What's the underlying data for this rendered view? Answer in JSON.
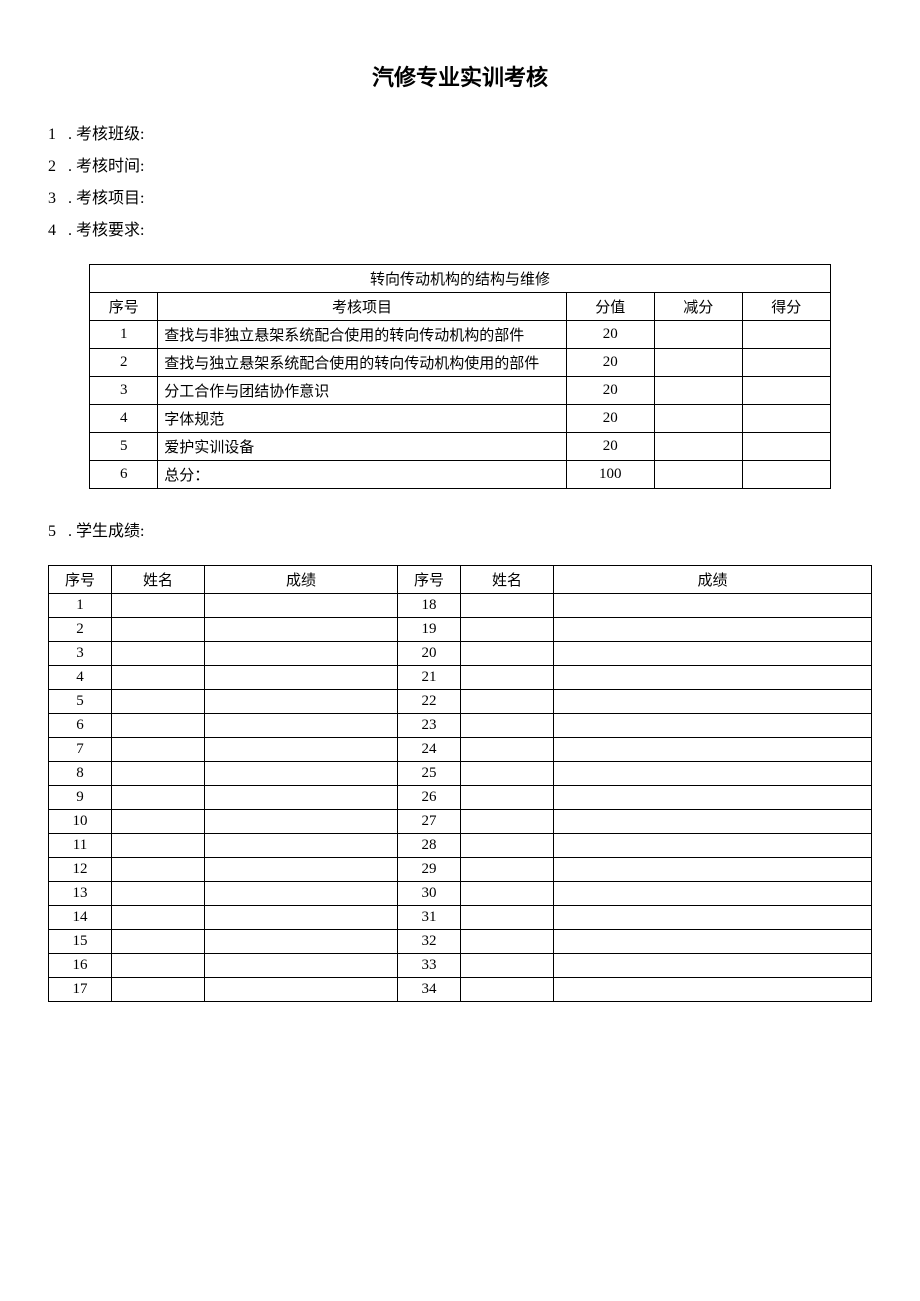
{
  "title": "汽修专业实训考核",
  "meta": [
    {
      "num": "1",
      "label": "考核班级:"
    },
    {
      "num": "2",
      "label": "考核时间:"
    },
    {
      "num": "3",
      "label": "考核项目:"
    },
    {
      "num": "4",
      "label": "考核要求:"
    }
  ],
  "assess": {
    "merged_title": "转向传动机构的结构与维修",
    "headers": {
      "seq": "序号",
      "item": "考核项目",
      "score": "分值",
      "deduct": "减分",
      "get": "得分"
    },
    "rows": [
      {
        "seq": "1",
        "item": "查找与非独立悬架系统配合使用的转向传动机构的部件",
        "score": "20",
        "deduct": "",
        "get": ""
      },
      {
        "seq": "2",
        "item": "查找与独立悬架系统配合使用的转向传动机构使用的部件",
        "score": "20",
        "deduct": "",
        "get": ""
      },
      {
        "seq": "3",
        "item": "分工合作与团结协作意识",
        "score": "20",
        "deduct": "",
        "get": ""
      },
      {
        "seq": "4",
        "item": "字体规范",
        "score": "20",
        "deduct": "",
        "get": ""
      },
      {
        "seq": "5",
        "item": "爱护实训设备",
        "score": "20",
        "deduct": "",
        "get": ""
      },
      {
        "seq": "6",
        "item": "总分：",
        "score": "100",
        "deduct": "",
        "get": ""
      }
    ]
  },
  "grades_meta": {
    "num": "5",
    "label": "学生成绩:"
  },
  "grades": {
    "headers": {
      "seq": "序号",
      "name": "姓名",
      "score": "成绩"
    },
    "rows": [
      {
        "l": "1",
        "r": "18"
      },
      {
        "l": "2",
        "r": "19"
      },
      {
        "l": "3",
        "r": "20"
      },
      {
        "l": "4",
        "r": "21"
      },
      {
        "l": "5",
        "r": "22"
      },
      {
        "l": "6",
        "r": "23"
      },
      {
        "l": "7",
        "r": "24"
      },
      {
        "l": "8",
        "r": "25"
      },
      {
        "l": "9",
        "r": "26"
      },
      {
        "l": "10",
        "r": "27"
      },
      {
        "l": "11",
        "r": "28"
      },
      {
        "l": "12",
        "r": "29"
      },
      {
        "l": "13",
        "r": "30"
      },
      {
        "l": "14",
        "r": "31"
      },
      {
        "l": "15",
        "r": "32"
      },
      {
        "l": "16",
        "r": "33"
      },
      {
        "l": "17",
        "r": "34"
      }
    ]
  }
}
